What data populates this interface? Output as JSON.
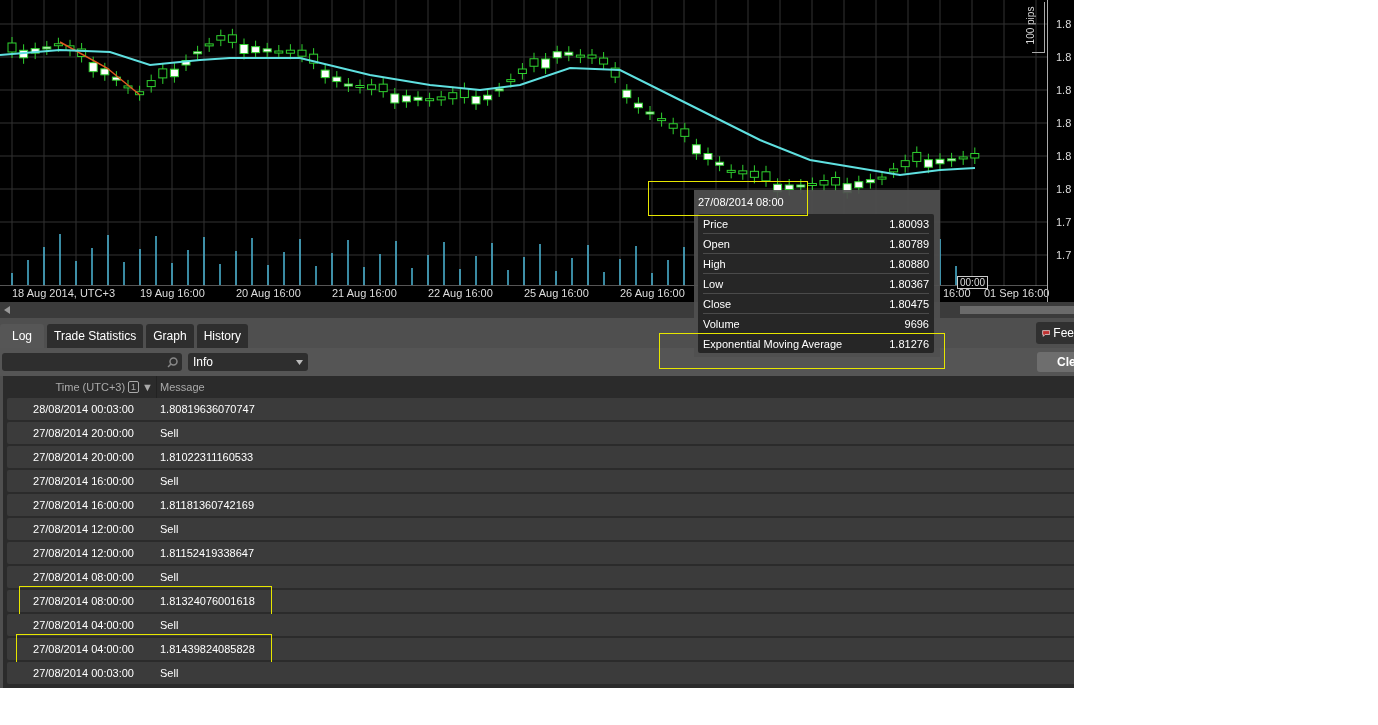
{
  "chart": {
    "scale_label": "100 pips",
    "price_labels": [
      "1.8",
      "1.8",
      "1.8",
      "1.8",
      "1.8",
      "1.8",
      "1.7",
      "1.7"
    ],
    "x_labels": [
      "18 Aug 2014, UTC+3",
      "19 Aug 16:00",
      "20 Aug 16:00",
      "21 Aug 16:00",
      "22 Aug 16:00",
      "25 Aug 16:00",
      "26 Aug 16:00",
      "16:00",
      "01 Sep 16:00"
    ],
    "cursor_time": "00:00"
  },
  "tooltip": {
    "title": "27/08/2014 08:00",
    "title_highlighted": true,
    "rows": [
      {
        "label": "Price",
        "value": "1.80093",
        "highlighted": false
      },
      {
        "label": "Open",
        "value": "1.80789",
        "highlighted": false
      },
      {
        "label": "High",
        "value": "1.80880",
        "highlighted": false
      },
      {
        "label": "Low",
        "value": "1.80367",
        "highlighted": false
      },
      {
        "label": "Close",
        "value": "1.80475",
        "highlighted": false
      },
      {
        "label": "Volume",
        "value": "9696",
        "highlighted": false
      },
      {
        "label": "Exponential Moving Average",
        "value": "1.81276",
        "highlighted": true
      }
    ]
  },
  "tabs": [
    {
      "label": "Log",
      "selected": true
    },
    {
      "label": "Trade Statistics",
      "selected": false
    },
    {
      "label": "Graph",
      "selected": false
    },
    {
      "label": "History",
      "selected": false
    }
  ],
  "filter": {
    "level": "Info"
  },
  "buttons": {
    "feedback": "Fee",
    "clear": "Cle"
  },
  "log": {
    "columns": [
      {
        "label": "Time (UTC+3)",
        "sort_rank": "1",
        "sort_arrow": "▼"
      },
      {
        "label": "Message"
      }
    ],
    "rows": [
      {
        "time": "28/08/2014 00:03:00",
        "message": "1.80819636070747",
        "highlighted": false
      },
      {
        "time": "27/08/2014 20:00:00",
        "message": "Sell",
        "highlighted": false
      },
      {
        "time": "27/08/2014 20:00:00",
        "message": "1.81022311160533",
        "highlighted": false
      },
      {
        "time": "27/08/2014 16:00:00",
        "message": "Sell",
        "highlighted": false
      },
      {
        "time": "27/08/2014 16:00:00",
        "message": "1.81181360742169",
        "highlighted": false
      },
      {
        "time": "27/08/2014 12:00:00",
        "message": "Sell",
        "highlighted": false
      },
      {
        "time": "27/08/2014 12:00:00",
        "message": "1.81152419338647",
        "highlighted": false
      },
      {
        "time": "27/08/2014 08:00:00",
        "message": "Sell",
        "highlighted": false
      },
      {
        "time": "27/08/2014 08:00:00",
        "message": "1.81324076001618",
        "highlighted": true
      },
      {
        "time": "27/08/2014 04:00:00",
        "message": "Sell",
        "highlighted": false
      },
      {
        "time": "27/08/2014 04:00:00",
        "message": "1.81439824085828",
        "highlighted": true
      },
      {
        "time": "27/08/2014 00:03:00",
        "message": "Sell",
        "highlighted": false
      }
    ]
  }
}
